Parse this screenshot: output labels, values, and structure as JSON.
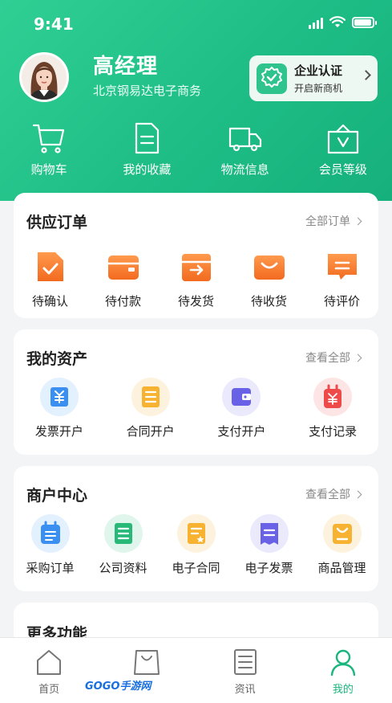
{
  "status": {
    "time": "9:41"
  },
  "user": {
    "name": "高经理",
    "company": "北京钢易达电子商务"
  },
  "certification": {
    "title": "企业认证",
    "subtitle": "开启新商机"
  },
  "quick_links": [
    {
      "label": "购物车",
      "icon": "cart-icon"
    },
    {
      "label": "我的收藏",
      "icon": "document-icon"
    },
    {
      "label": "物流信息",
      "icon": "truck-icon"
    },
    {
      "label": "会员等级",
      "icon": "vip-icon"
    }
  ],
  "orders": {
    "title": "供应订单",
    "more": "全部订单",
    "items": [
      {
        "label": "待确认",
        "icon": "confirm-icon"
      },
      {
        "label": "待付款",
        "icon": "wallet-icon"
      },
      {
        "label": "待发货",
        "icon": "ship-icon"
      },
      {
        "label": "待收货",
        "icon": "receive-box-icon"
      },
      {
        "label": "待评价",
        "icon": "comment-icon"
      }
    ]
  },
  "assets": {
    "title": "我的资产",
    "more": "查看全部",
    "items": [
      {
        "label": "发票开户",
        "icon": "invoice-yen-icon"
      },
      {
        "label": "合同开户",
        "icon": "contract-icon"
      },
      {
        "label": "支付开户",
        "icon": "wallet-card-icon"
      },
      {
        "label": "支付记录",
        "icon": "payment-record-icon"
      }
    ]
  },
  "merchant": {
    "title": "商户中心",
    "more": "查看全部",
    "items": [
      {
        "label": "采购订单",
        "icon": "purchase-order-icon"
      },
      {
        "label": "公司资料",
        "icon": "company-info-icon"
      },
      {
        "label": "电子合同",
        "icon": "e-contract-icon"
      },
      {
        "label": "电子发票",
        "icon": "e-invoice-icon"
      },
      {
        "label": "商品管理",
        "icon": "product-manage-icon"
      }
    ]
  },
  "more_section": {
    "title": "更多功能"
  },
  "tabbar": [
    {
      "label": "首页",
      "icon": "home-icon",
      "active": false
    },
    {
      "label": "",
      "icon": "shopping-bag-icon",
      "active": false
    },
    {
      "label": "资讯",
      "icon": "news-icon",
      "active": false
    },
    {
      "label": "我的",
      "icon": "profile-icon",
      "active": true
    }
  ],
  "watermark": "GOGO手游网",
  "colors": {
    "brand": "#1ebd86",
    "orange": "#f47a2e",
    "background": "#f3f4f6"
  }
}
